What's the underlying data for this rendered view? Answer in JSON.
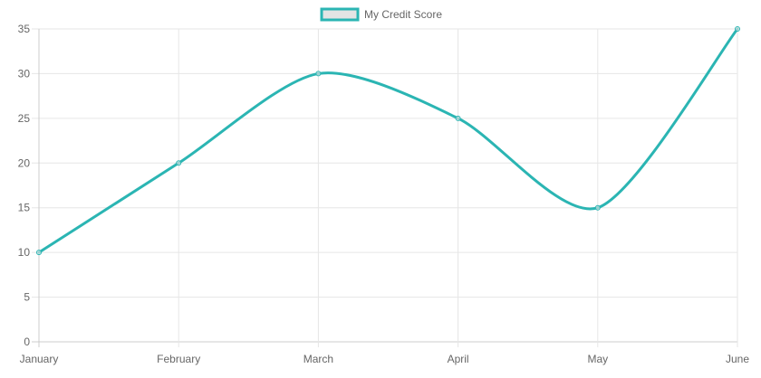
{
  "chart_data": {
    "type": "line",
    "categories": [
      "January",
      "February",
      "March",
      "April",
      "May",
      "June"
    ],
    "series": [
      {
        "name": "My Credit Score",
        "values": [
          10,
          20,
          30,
          25,
          15,
          35
        ],
        "color": "#2bb5b3"
      }
    ],
    "ylim": [
      0,
      35
    ],
    "yticks": [
      "0",
      "5",
      "10",
      "15",
      "20",
      "25",
      "30",
      "35"
    ],
    "legend_position": "top-center",
    "grid": true,
    "curve": "smooth"
  },
  "colors": {
    "line": "#2bb5b3",
    "legend_fill": "#e4e4e4",
    "grid": "#e6e6e6",
    "text": "#666666"
  }
}
